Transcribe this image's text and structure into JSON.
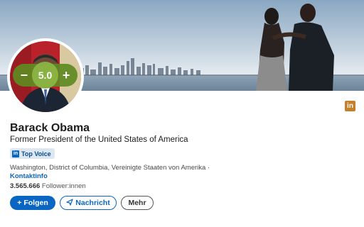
{
  "profile": {
    "name": "Barack Obama",
    "headline": "Former President of the United States of America",
    "badge_label": "Top Voice",
    "location_prefix": "Washington, District of Columbia, Vereinigte Staaten von Amerika ·",
    "contact_label": "Kontaktinfo",
    "followers_count": "3.565.666",
    "followers_label": "Follower:innen"
  },
  "zoom": {
    "minus": "−",
    "value": "5.0",
    "plus": "+"
  },
  "actions": {
    "follow_icon": "+",
    "follow": "Folgen",
    "message_icon": "paper-plane-icon",
    "message": "Nachricht",
    "more": "Mehr"
  },
  "icons": {
    "linkedin_badge": "in"
  },
  "colors": {
    "linkedin_blue": "#0a66c2",
    "zoom_green": "#5f8a23",
    "badge_orange": "#c47f2b"
  }
}
